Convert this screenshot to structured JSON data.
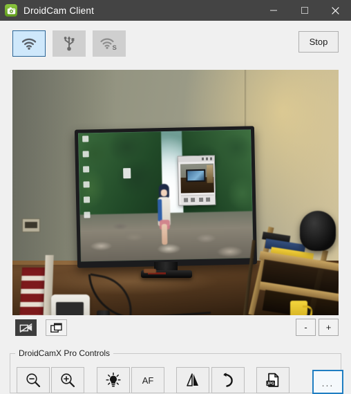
{
  "window": {
    "title": "DroidCam Client",
    "app_icon": "droidcam-camera-icon",
    "controls": {
      "minimize": "minimize-icon",
      "maximize": "maximize-icon",
      "close": "close-icon"
    },
    "titlebar_color": "#444444",
    "body_color": "#f0f0f0"
  },
  "toolbar": {
    "modes": [
      {
        "id": "wifi",
        "icon": "wifi-icon",
        "label": "WiFi",
        "selected": true
      },
      {
        "id": "usb",
        "icon": "usb-icon",
        "label": "USB",
        "selected": false
      },
      {
        "id": "wifis",
        "icon": "wifi-server-icon",
        "label": "WiFi Server",
        "selected": false
      }
    ],
    "selected_color": "#cfe8fb",
    "stop_label": "Stop"
  },
  "preview": {
    "description": "Live camera preview: desk with monitor showing forest wallpaper, bookshelf, lamp"
  },
  "midrow": {
    "buttons": [
      {
        "id": "camoff",
        "icon": "camera-off-icon",
        "label": ""
      },
      {
        "id": "window",
        "icon": "windows-overlap-icon",
        "label": ""
      }
    ],
    "zoom_minus": "-",
    "zoom_plus": "+"
  },
  "pro_controls": {
    "legend": "DroidCamX Pro Controls",
    "buttons": [
      {
        "id": "zoomout",
        "icon": "zoom-out-icon",
        "label": ""
      },
      {
        "id": "zoomin",
        "icon": "zoom-in-icon",
        "label": ""
      },
      {
        "id": "flash",
        "icon": "light-bulb-icon",
        "label": ""
      },
      {
        "id": "af",
        "icon": "autofocus-text",
        "label": "AF"
      },
      {
        "id": "mirror",
        "icon": "mirror-flip-icon",
        "label": ""
      },
      {
        "id": "rotate",
        "icon": "rotate-icon",
        "label": ""
      },
      {
        "id": "snap",
        "icon": "jpg-save-icon",
        "label": ""
      },
      {
        "id": "more",
        "icon": "ellipsis-icon",
        "label": "..."
      }
    ],
    "focus_color": "#1f7ec2"
  }
}
